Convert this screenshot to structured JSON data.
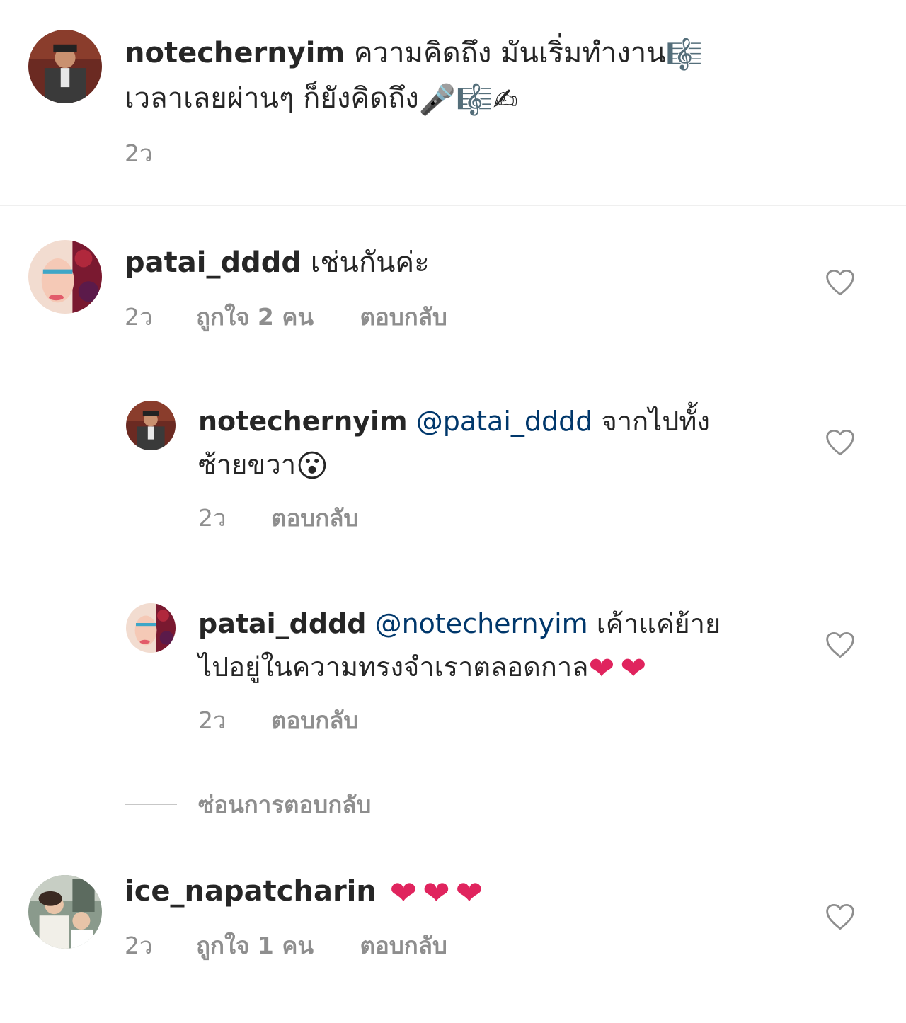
{
  "caption": {
    "username": "notechernyim",
    "line1": "ความคิดถึง มันเริ่มทำงาน",
    "line2": "เวลาเลยผ่านๆ ก็ยังคิดถึง",
    "time": "2ว"
  },
  "comments": [
    {
      "username": "patai_dddd",
      "text": "เช่นกันค่ะ",
      "time": "2ว",
      "likes": "ถูกใจ 2 คน",
      "reply_label": "ตอบกลับ",
      "replies": [
        {
          "username": "notechernyim",
          "mention": "@patai_dddd",
          "text_line1": "จากไปทั้ง",
          "text_line2": "ซ้ายขวา",
          "time": "2ว",
          "reply_label": "ตอบกลับ"
        },
        {
          "username": "patai_dddd",
          "mention": "@notechernyim",
          "text_line1": "เค้าแค่ย้าย",
          "text_line2": "ไปอยู่ในความทรงจำเราตลอดกาล",
          "time": "2ว",
          "reply_label": "ตอบกลับ"
        }
      ],
      "hide_replies": "ซ่อนการตอบกลับ"
    },
    {
      "username": "ice_napatcharin",
      "text": "",
      "time": "2ว",
      "likes": "ถูกใจ 1 คน",
      "reply_label": "ตอบกลับ"
    }
  ],
  "colors": {
    "text": "#262626",
    "meta": "#8e8e8e",
    "mention": "#00376b",
    "heart_outline": "#8e8e8e"
  }
}
